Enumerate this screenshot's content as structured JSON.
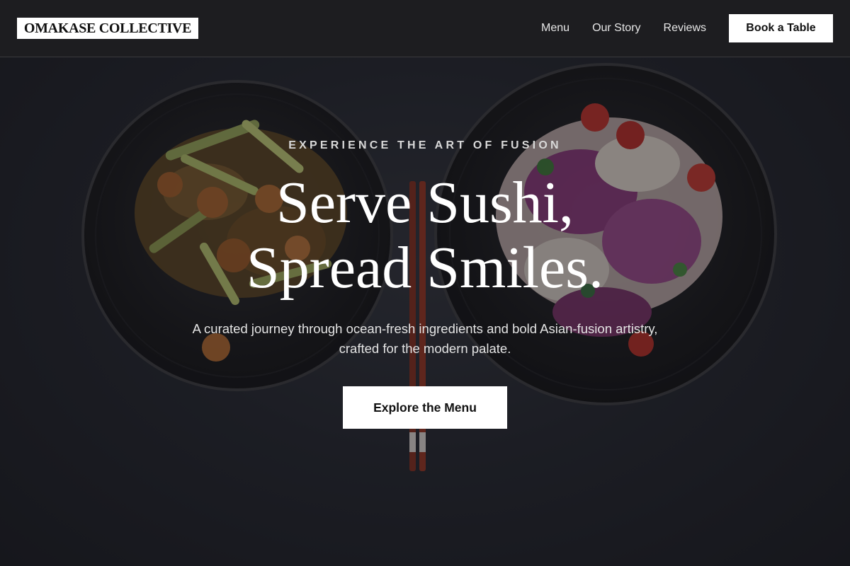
{
  "brand": {
    "name": "OMAKASE COLLECTIVE"
  },
  "nav": {
    "items": [
      {
        "label": "Menu"
      },
      {
        "label": "Our Story"
      },
      {
        "label": "Reviews"
      }
    ],
    "cta_label": "Book a Table"
  },
  "hero": {
    "eyebrow": "EXPERIENCE THE ART OF FUSION",
    "headline_line1": "Serve Sushi,",
    "headline_line2": "Spread Smiles.",
    "subtext": "A curated journey through ocean-fresh ingredients and bold Asian-fusion artistry, crafted for the modern palate.",
    "cta_label": "Explore the Menu",
    "background_image": "two dark bowls of stir-fried shrimp with celery and purple cabbage salad, chopsticks between them"
  },
  "colors": {
    "header_bg": "#1d1d20",
    "hero_bg": "#24262d",
    "button_bg": "#ffffff",
    "button_text": "#111111",
    "text_primary": "#ffffff",
    "text_muted": "#e4e4e4"
  }
}
